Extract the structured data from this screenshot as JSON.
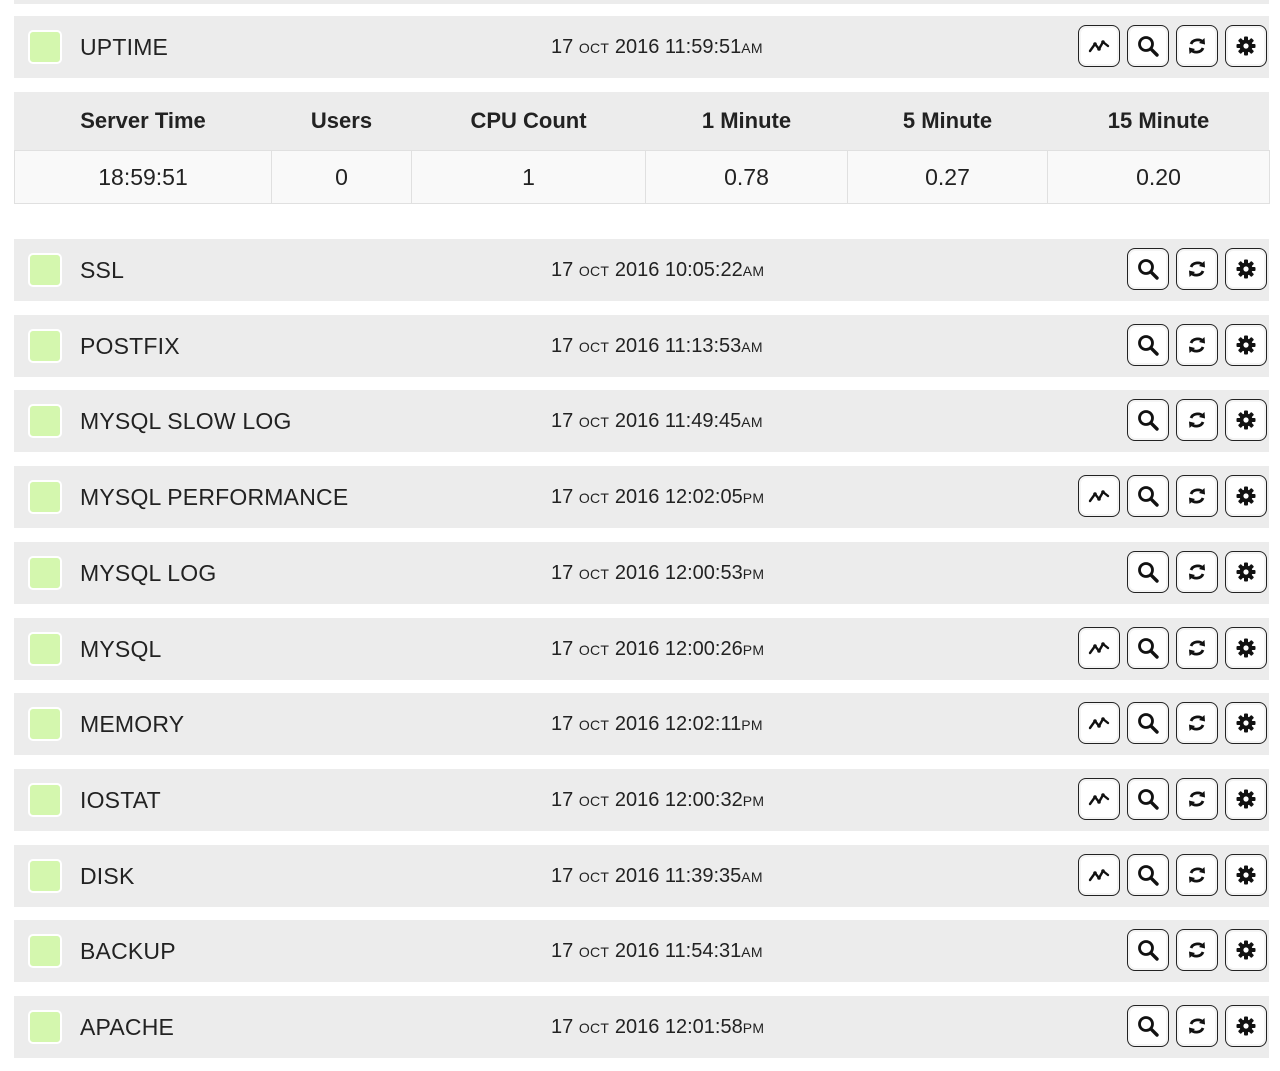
{
  "colors": {
    "row_bg": "#ececec",
    "status_ok": "#d4f7ae",
    "button_border": "#222222"
  },
  "icons": {
    "graph": "line-chart-icon",
    "search": "magnifier-icon",
    "refresh": "refresh-arrows-icon",
    "settings": "gear-icon"
  },
  "uptime": {
    "name": "UPTIME",
    "date": {
      "day": "17",
      "month": "OCT",
      "year_time": "2016 11:59:51",
      "ampm": "AM"
    },
    "has_graph": true
  },
  "stats": {
    "headers": [
      "Server Time",
      "Users",
      "CPU Count",
      "1 Minute",
      "5 Minute",
      "15 Minute"
    ],
    "values": [
      "18:59:51",
      "0",
      "1",
      "0.78",
      "0.27",
      "0.20"
    ]
  },
  "services": [
    {
      "name": "SSL",
      "date": {
        "day": "17",
        "month": "OCT",
        "year_time": "2016 10:05:22",
        "ampm": "AM"
      },
      "has_graph": false
    },
    {
      "name": "POSTFIX",
      "date": {
        "day": "17",
        "month": "OCT",
        "year_time": "2016 11:13:53",
        "ampm": "AM"
      },
      "has_graph": false
    },
    {
      "name": "MYSQL SLOW LOG",
      "date": {
        "day": "17",
        "month": "OCT",
        "year_time": "2016 11:49:45",
        "ampm": "AM"
      },
      "has_graph": false
    },
    {
      "name": "MYSQL PERFORMANCE",
      "date": {
        "day": "17",
        "month": "OCT",
        "year_time": "2016 12:02:05",
        "ampm": "PM"
      },
      "has_graph": true
    },
    {
      "name": "MYSQL LOG",
      "date": {
        "day": "17",
        "month": "OCT",
        "year_time": "2016 12:00:53",
        "ampm": "PM"
      },
      "has_graph": false
    },
    {
      "name": "MYSQL",
      "date": {
        "day": "17",
        "month": "OCT",
        "year_time": "2016 12:00:26",
        "ampm": "PM"
      },
      "has_graph": true
    },
    {
      "name": "MEMORY",
      "date": {
        "day": "17",
        "month": "OCT",
        "year_time": "2016 12:02:11",
        "ampm": "PM"
      },
      "has_graph": true
    },
    {
      "name": "IOSTAT",
      "date": {
        "day": "17",
        "month": "OCT",
        "year_time": "2016 12:00:32",
        "ampm": "PM"
      },
      "has_graph": true
    },
    {
      "name": "DISK",
      "date": {
        "day": "17",
        "month": "OCT",
        "year_time": "2016 11:39:35",
        "ampm": "AM"
      },
      "has_graph": true
    },
    {
      "name": "BACKUP",
      "date": {
        "day": "17",
        "month": "OCT",
        "year_time": "2016 11:54:31",
        "ampm": "AM"
      },
      "has_graph": false
    },
    {
      "name": "APACHE",
      "date": {
        "day": "17",
        "month": "OCT",
        "year_time": "2016 12:01:58",
        "ampm": "PM"
      },
      "has_graph": false
    }
  ]
}
